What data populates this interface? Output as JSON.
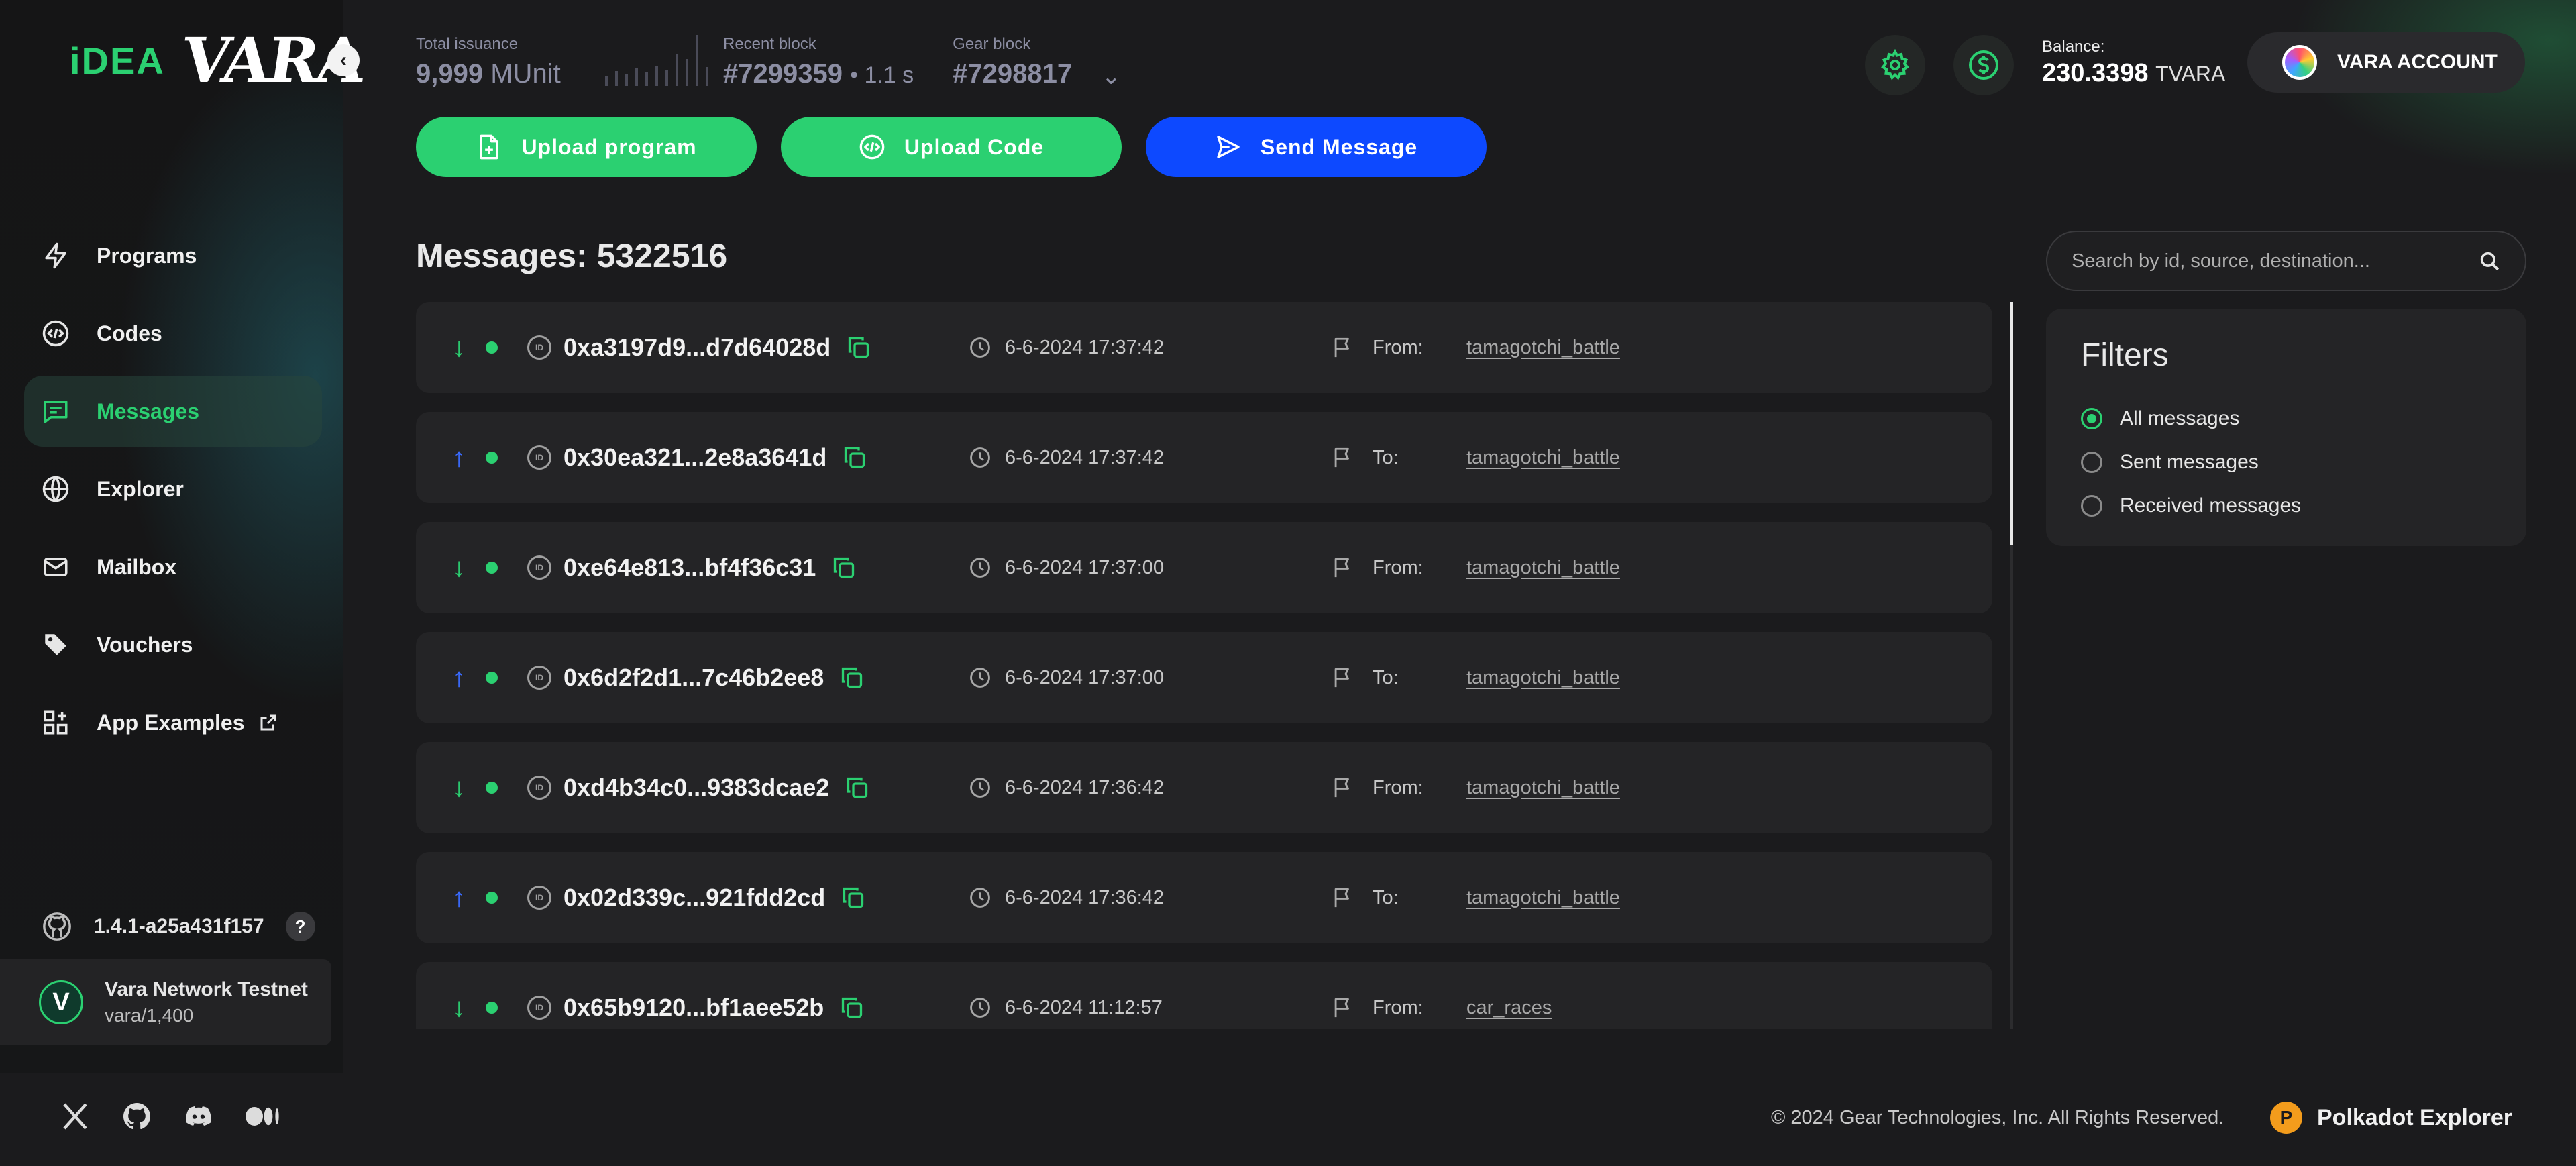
{
  "logo": {
    "idea": "iDEA",
    "vara": "VARA"
  },
  "header": {
    "total_issuance_label": "Total issuance",
    "total_issuance_value": "9,999",
    "total_issuance_unit": "MUnit",
    "recent_block_label": "Recent block",
    "recent_block_value": "#7299359",
    "recent_block_time": "• 1.1 s",
    "gear_block_label": "Gear block",
    "gear_block_value": "#7298817",
    "balance_label": "Balance:",
    "balance_value": "230.3398",
    "balance_unit": "TVARA",
    "account_label": "VARA ACCOUNT"
  },
  "sidebar": {
    "items": [
      {
        "label": "Programs",
        "icon": "lightning-icon"
      },
      {
        "label": "Codes",
        "icon": "code-icon"
      },
      {
        "label": "Messages",
        "icon": "message-icon",
        "active": true
      },
      {
        "label": "Explorer",
        "icon": "globe-icon"
      },
      {
        "label": "Mailbox",
        "icon": "mail-icon"
      },
      {
        "label": "Vouchers",
        "icon": "tag-icon"
      },
      {
        "label": "App Examples",
        "icon": "apps-icon"
      }
    ],
    "version": "1.4.1-a25a431f157",
    "help": "?",
    "network_name": "Vara Network Testnet",
    "network_sub": "vara/1,400"
  },
  "actions": {
    "upload_program": "Upload program",
    "upload_code": "Upload Code",
    "send_message": "Send Message"
  },
  "messages": {
    "title": "Messages: 5322516",
    "rows": [
      {
        "direction": "in",
        "id": "0xa3197d9...d7d64028d",
        "time": "6-6-2024 17:37:42",
        "party_label": "From:",
        "program": "tamagotchi_battle"
      },
      {
        "direction": "out",
        "id": "0x30ea321...2e8a3641d",
        "time": "6-6-2024 17:37:42",
        "party_label": "To:",
        "program": "tamagotchi_battle"
      },
      {
        "direction": "in",
        "id": "0xe64e813...bf4f36c31",
        "time": "6-6-2024 17:37:00",
        "party_label": "From:",
        "program": "tamagotchi_battle"
      },
      {
        "direction": "out",
        "id": "0x6d2f2d1...7c46b2ee8",
        "time": "6-6-2024 17:37:00",
        "party_label": "To:",
        "program": "tamagotchi_battle"
      },
      {
        "direction": "in",
        "id": "0xd4b34c0...9383dcae2",
        "time": "6-6-2024 17:36:42",
        "party_label": "From:",
        "program": "tamagotchi_battle"
      },
      {
        "direction": "out",
        "id": "0x02d339c...921fdd2cd",
        "time": "6-6-2024 17:36:42",
        "party_label": "To:",
        "program": "tamagotchi_battle"
      },
      {
        "direction": "in",
        "id": "0x65b9120...bf1aee52b",
        "time": "6-6-2024 11:12:57",
        "party_label": "From:",
        "program": "car_races"
      }
    ]
  },
  "search": {
    "placeholder": "Search by id, source, destination..."
  },
  "filters": {
    "title": "Filters",
    "options": [
      {
        "label": "All messages",
        "checked": true
      },
      {
        "label": "Sent messages",
        "checked": false
      },
      {
        "label": "Received messages",
        "checked": false
      }
    ]
  },
  "footer": {
    "copyright": "© 2024 Gear Technologies, Inc. All Rights Reserved.",
    "polkadot": "Polkadot Explorer"
  },
  "colors": {
    "accent_green": "#2bd071",
    "accent_blue": "#0d49ff",
    "background": "#1b1b1d"
  }
}
